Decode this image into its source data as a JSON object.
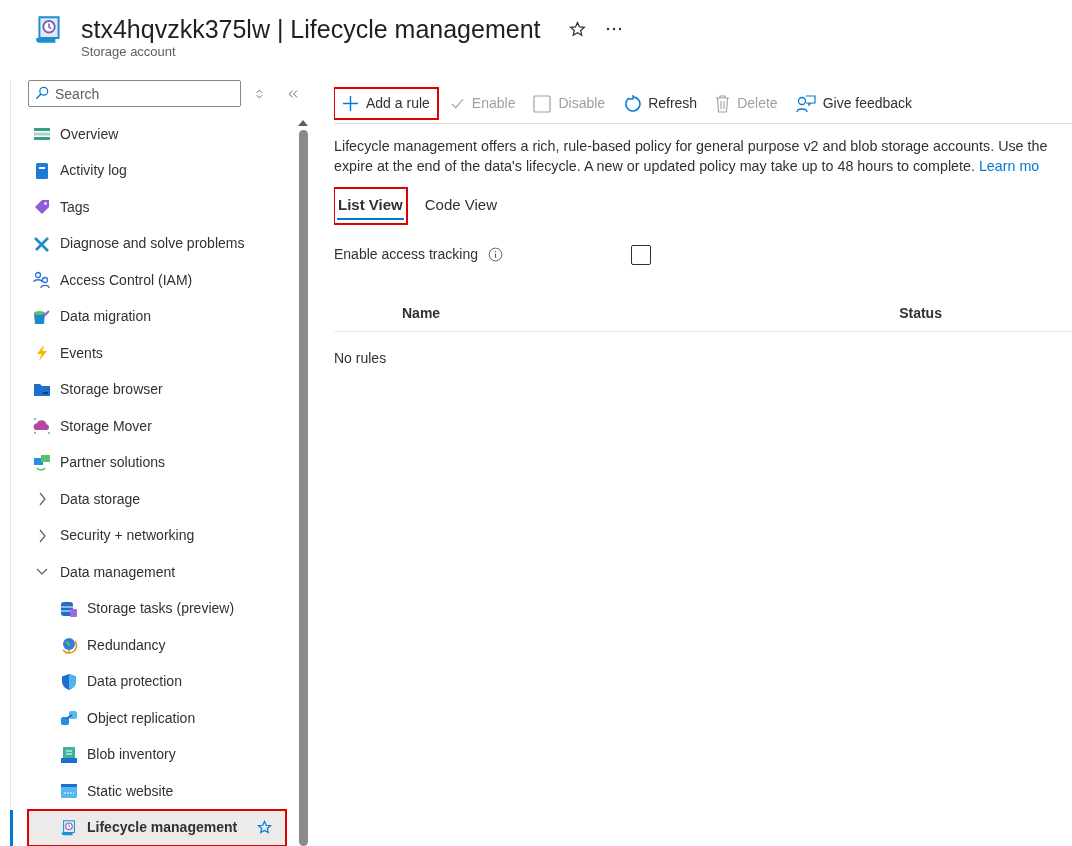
{
  "header": {
    "title": "stx4hqvzkk375lw | Lifecycle management",
    "subtitle": "Storage account"
  },
  "sidebar": {
    "search": {
      "placeholder": "Search"
    },
    "items": [
      {
        "label": "Overview",
        "kind": "item",
        "selected": false
      },
      {
        "label": "Activity log",
        "kind": "item",
        "selected": false
      },
      {
        "label": "Tags",
        "kind": "item",
        "selected": false
      },
      {
        "label": "Diagnose and solve problems",
        "kind": "item",
        "selected": false
      },
      {
        "label": "Access Control (IAM)",
        "kind": "item",
        "selected": false
      },
      {
        "label": "Data migration",
        "kind": "item",
        "selected": false
      },
      {
        "label": "Events",
        "kind": "item",
        "selected": false
      },
      {
        "label": "Storage browser",
        "kind": "item",
        "selected": false
      },
      {
        "label": "Storage Mover",
        "kind": "item",
        "selected": false
      },
      {
        "label": "Partner solutions",
        "kind": "item",
        "selected": false
      },
      {
        "label": "Data storage",
        "kind": "group",
        "expanded": false
      },
      {
        "label": "Security + networking",
        "kind": "group",
        "expanded": false
      },
      {
        "label": "Data management",
        "kind": "group",
        "expanded": true,
        "children": [
          {
            "label": "Storage tasks (preview)",
            "kind": "item",
            "selected": false
          },
          {
            "label": "Redundancy",
            "kind": "item",
            "selected": false
          },
          {
            "label": "Data protection",
            "kind": "item",
            "selected": false
          },
          {
            "label": "Object replication",
            "kind": "item",
            "selected": false
          },
          {
            "label": "Blob inventory",
            "kind": "item",
            "selected": false
          },
          {
            "label": "Static website",
            "kind": "item",
            "selected": false
          },
          {
            "label": "Lifecycle management",
            "kind": "item",
            "selected": true,
            "highlighted": true,
            "favorite": true
          }
        ]
      }
    ]
  },
  "toolbar": [
    {
      "label": "Add a rule",
      "kind": "add",
      "disabled": false,
      "highlighted": true
    },
    {
      "label": "Enable",
      "kind": "enable",
      "disabled": true,
      "highlighted": false
    },
    {
      "label": "Disable",
      "kind": "disable",
      "disabled": true,
      "highlighted": false
    },
    {
      "label": "Refresh",
      "kind": "refresh",
      "disabled": false,
      "highlighted": false
    },
    {
      "label": "Delete",
      "kind": "delete",
      "disabled": true,
      "highlighted": false
    },
    {
      "label": "Give feedback",
      "kind": "feedback",
      "disabled": false,
      "highlighted": false
    }
  ],
  "description": {
    "lines": [
      "Lifecycle management offers a rich, rule-based policy for general purpose v2 and blob storage accounts. Use the",
      "expire at the end of the data's lifecycle. A new or updated policy may take up to 48 hours to complete."
    ],
    "link": "Learn mo"
  },
  "tabs": [
    {
      "label": "List View",
      "selected": true,
      "highlighted": true
    },
    {
      "label": "Code View",
      "selected": false,
      "highlighted": false
    }
  ],
  "access_tracking": {
    "label": "Enable access tracking",
    "checked": false
  },
  "table": {
    "columns": [
      "Name",
      "Status"
    ],
    "empty_text": "No rules"
  }
}
